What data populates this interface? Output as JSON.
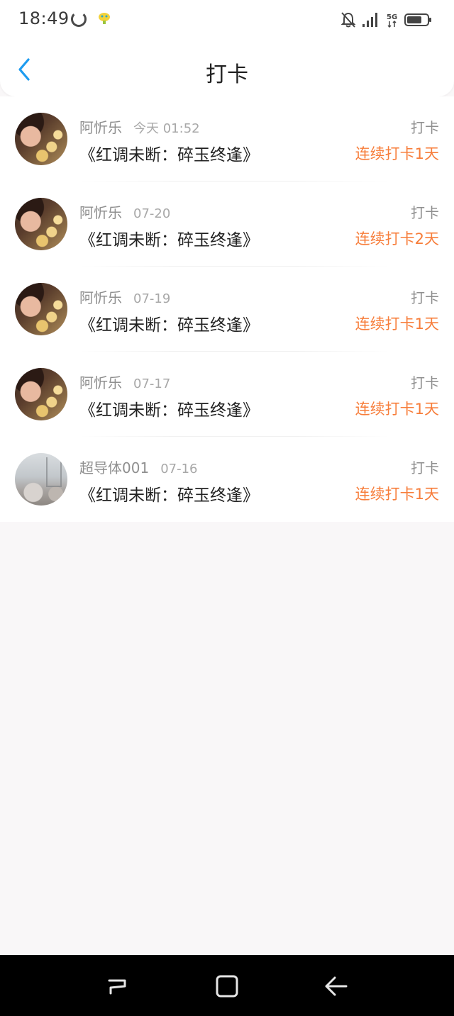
{
  "status_bar": {
    "time": "18:49",
    "icons": [
      "sync-icon",
      "app-mascot-icon",
      "mute-bell-icon",
      "signal-icon",
      "5g-icon",
      "battery-icon"
    ]
  },
  "header": {
    "title": "打卡",
    "back_icon": "chevron-left-icon"
  },
  "records": [
    {
      "user": "阿忻乐",
      "date": "今天 01:52",
      "book": "《红调未断：碎玉终逢》",
      "action": "打卡",
      "streak": "连续打卡1天",
      "avatar": "avatar-flowers-portrait"
    },
    {
      "user": "阿忻乐",
      "date": "07-20",
      "book": "《红调未断：碎玉终逢》",
      "action": "打卡",
      "streak": "连续打卡2天",
      "avatar": "avatar-flowers-portrait"
    },
    {
      "user": "阿忻乐",
      "date": "07-19",
      "book": "《红调未断：碎玉终逢》",
      "action": "打卡",
      "streak": "连续打卡1天",
      "avatar": "avatar-flowers-portrait"
    },
    {
      "user": "阿忻乐",
      "date": "07-17",
      "book": "《红调未断：碎玉终逢》",
      "action": "打卡",
      "streak": "连续打卡1天",
      "avatar": "avatar-flowers-portrait"
    },
    {
      "user": "超导体001",
      "date": "07-16",
      "book": "《红调未断：碎玉终逢》",
      "action": "打卡",
      "streak": "连续打卡1天",
      "avatar": "avatar-cats-photo"
    }
  ],
  "colors": {
    "accent": "#1e9cf0",
    "streak": "#f77d3a",
    "page_bg": "#f9f7f8"
  },
  "system_nav": [
    "recents-icon",
    "home-icon",
    "back-arrow-icon"
  ]
}
